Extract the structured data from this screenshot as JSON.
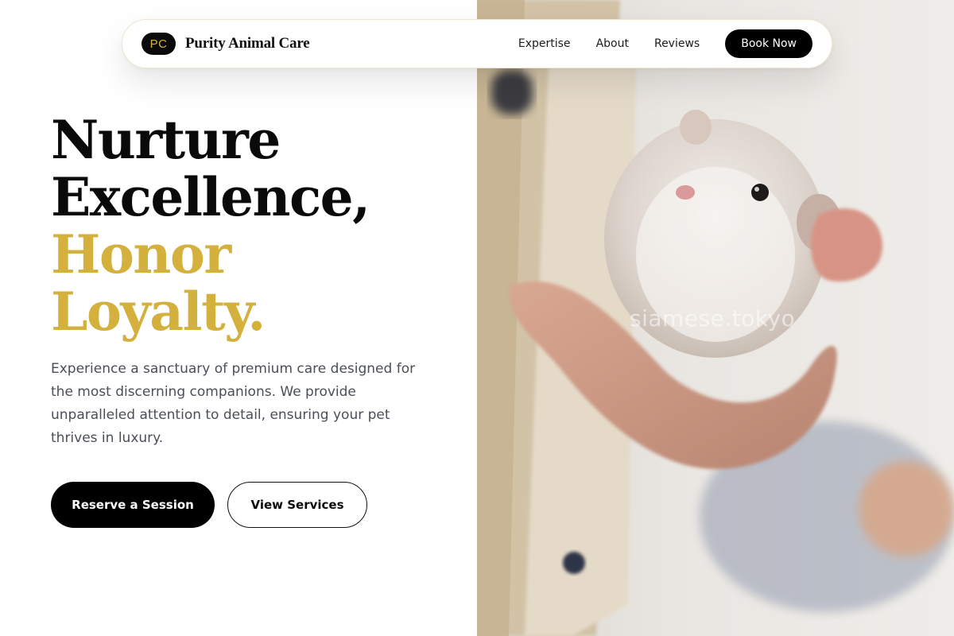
{
  "brand": {
    "logo_initials": "PC",
    "name": "Purity Animal Care"
  },
  "nav": {
    "links": [
      "Expertise",
      "About",
      "Reviews"
    ],
    "cta_label": "Book Now"
  },
  "hero": {
    "headline_lines": [
      "Nurture",
      "Excellence,"
    ],
    "headline_accent_lines": [
      "Honor",
      "Loyalty."
    ],
    "subtext": "Experience a sanctuary of premium care designed for the most discerning companions. We provide unparalleled attention to detail, ensuring your pet thrives in luxury.",
    "primary_cta": "Reserve a Session",
    "secondary_cta": "View Services"
  },
  "image": {
    "subject": "hamster-in-hand-photo",
    "watermark": "siamese.tokyo"
  },
  "colors": {
    "accent_gold": "#d4b03c",
    "primary_black": "#000000",
    "body_text": "#4a4f57",
    "background": "#ffffff"
  }
}
